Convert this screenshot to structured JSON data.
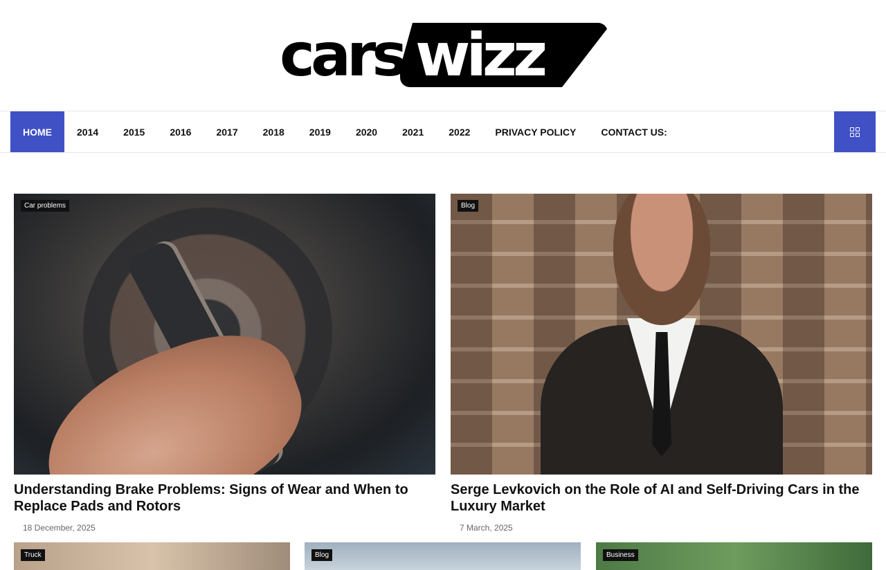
{
  "site": {
    "logo_text_left": "cars",
    "logo_text_right": "wizz"
  },
  "nav": {
    "items": [
      {
        "label": "HOME",
        "active": true
      },
      {
        "label": "2014"
      },
      {
        "label": "2015"
      },
      {
        "label": "2016"
      },
      {
        "label": "2017"
      },
      {
        "label": "2018"
      },
      {
        "label": "2019"
      },
      {
        "label": "2020"
      },
      {
        "label": "2021"
      },
      {
        "label": "2022"
      },
      {
        "label": "PRIVACY POLICY"
      },
      {
        "label": "CONTACT US:"
      }
    ],
    "menu_icon": "grid-icon",
    "accent_color": "#3f51c5"
  },
  "featured": [
    {
      "category": "Car problems",
      "title": "Understanding Brake Problems: Signs of Wear and When to Replace Pads and Rotors",
      "date": "18 December, 2025"
    },
    {
      "category": "Blog",
      "title": "Serge Levkovich on the Role of AI and Self-Driving Cars in the Luxury Market",
      "date": "7 March, 2025"
    }
  ],
  "more_posts": [
    {
      "category": "Truck"
    },
    {
      "category": "Blog"
    },
    {
      "category": "Business"
    }
  ]
}
